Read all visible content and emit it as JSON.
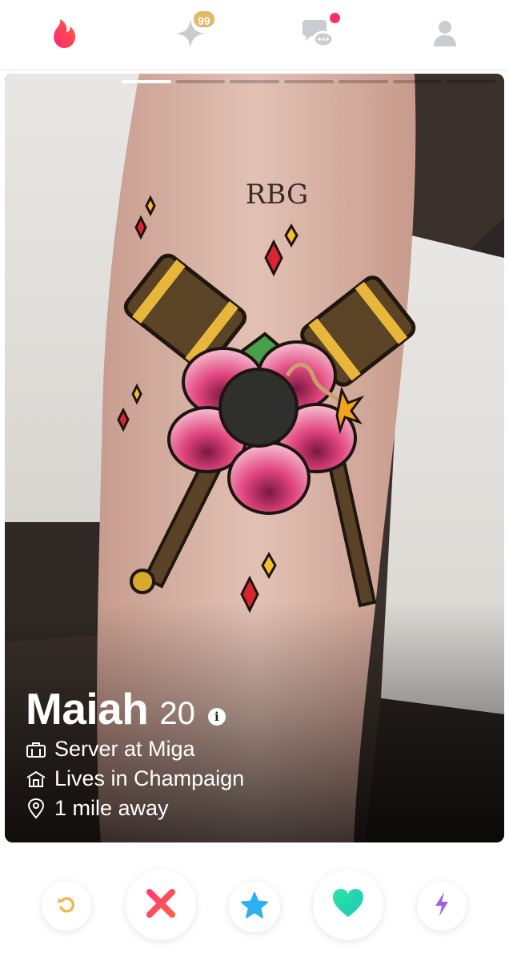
{
  "nav": {
    "items": [
      {
        "icon": "flame-icon",
        "label": "Home"
      },
      {
        "icon": "gold-sparkle-icon",
        "label": "Likes You"
      },
      {
        "icon": "chat-bubbles-icon",
        "label": "Messages"
      },
      {
        "icon": "profile-icon",
        "label": "Profile"
      }
    ],
    "gold_badge_count": "99",
    "chat_has_unread": true
  },
  "profile": {
    "name": "Maiah",
    "age": "20",
    "info_glyph": "i",
    "photo_count": 7,
    "active_photo_index": 0,
    "photo_tattoo_text": "RBG",
    "details": [
      {
        "icon": "briefcase-icon",
        "text": "Server at Miga"
      },
      {
        "icon": "home-icon",
        "text": "Lives in Champaign"
      },
      {
        "icon": "location-pin-icon",
        "text": "1 mile away"
      }
    ]
  },
  "actions": [
    {
      "name": "rewind",
      "icon": "rewind-icon",
      "color": "#f5b748"
    },
    {
      "name": "nope",
      "icon": "close-x-icon",
      "color": "#fd4d64"
    },
    {
      "name": "super-like",
      "icon": "star-icon",
      "color": "#2db0f2"
    },
    {
      "name": "like",
      "icon": "heart-icon",
      "color": "#1fd3a8"
    },
    {
      "name": "boost",
      "icon": "lightning-icon",
      "color": "#a35ee4"
    }
  ],
  "colors": {
    "brand_flame": "#fd4362",
    "nav_inactive": "#c9cdd2",
    "gold": "#e2b765",
    "notification": "#fd2f6a"
  }
}
